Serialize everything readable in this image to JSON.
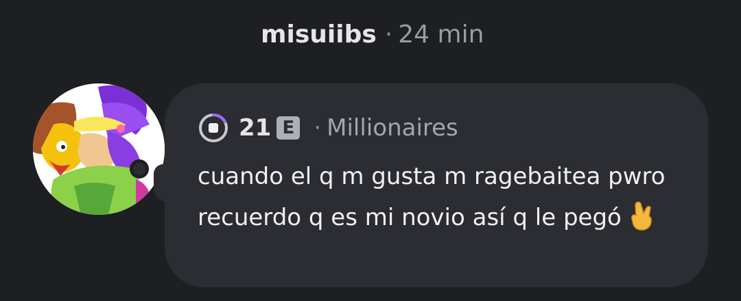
{
  "post": {
    "username": "misuiibs",
    "separator": "·",
    "time": "24 min"
  },
  "comment": {
    "level": "21",
    "badge": "E",
    "separator": "·",
    "community": "Millionaires",
    "text": "cuando el q m gusta m ragebaitea pwro recuerdo q es mi novio así q le pegó",
    "emoji": "crossed-fingers-icon"
  },
  "colors": {
    "background": "#1e1f22",
    "bubble": "#2b2d33",
    "level_ring": "#9b6cf2"
  }
}
